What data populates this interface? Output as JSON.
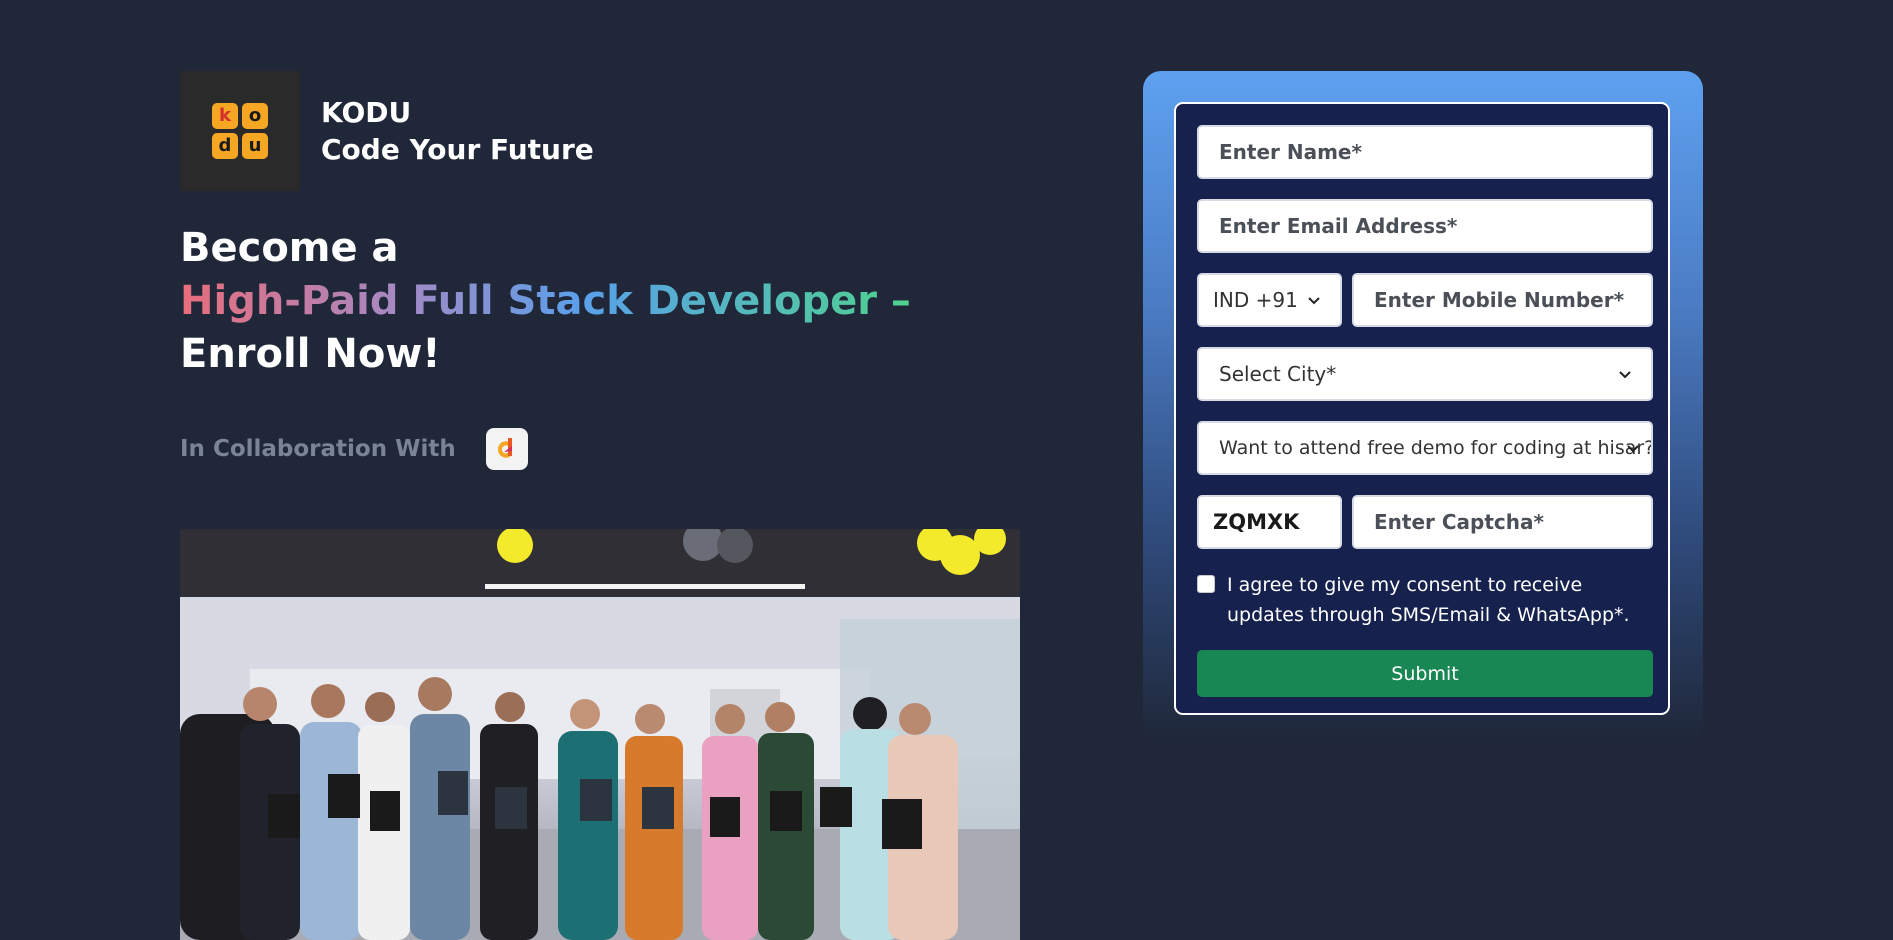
{
  "brand": {
    "logo_letters": [
      "k",
      "o",
      "d",
      "u"
    ],
    "name": "KODU",
    "tagline": "Code Your Future"
  },
  "headline": {
    "line1": "Become a",
    "line2": "High-Paid Full Stack Developer –",
    "line3": "Enroll Now!"
  },
  "collab": {
    "label": "In Collaboration With",
    "partner_icon": "partner-logo-icon"
  },
  "form": {
    "name_placeholder": "Enter Name*",
    "email_placeholder": "Enter Email Address*",
    "country_code": "IND +91",
    "mobile_placeholder": "Enter Mobile Number*",
    "city_placeholder": "Select City*",
    "demo_select": "Want to attend free demo for coding at hisar?*",
    "captcha_code": "ZQMXK",
    "captcha_placeholder": "Enter Captcha*",
    "consent_text": "I agree to give my consent to receive updates through SMS/Email & WhatsApp*.",
    "submit_label": "Submit"
  },
  "colors": {
    "background": "#1f2739",
    "card": "#16214e",
    "submit": "#198754",
    "logo_accent": "#f5a623"
  }
}
